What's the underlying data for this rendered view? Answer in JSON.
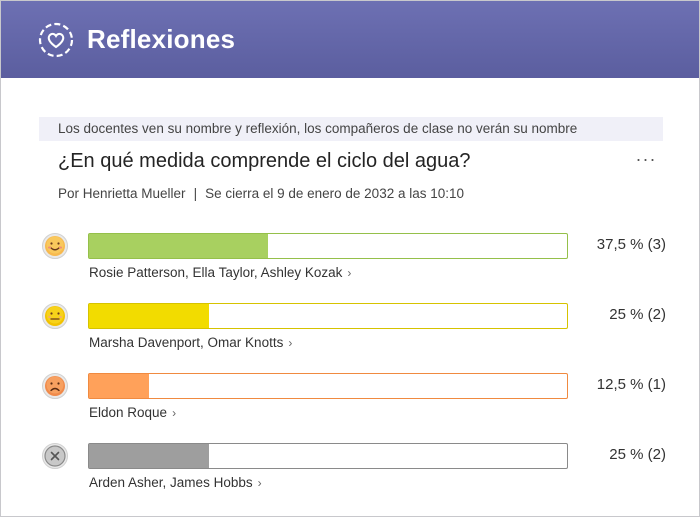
{
  "header": {
    "title": "Reflexiones",
    "logo_icon": "heart-in-circle-icon"
  },
  "notice": "Los docentes ven su nombre y reflexión, los compañeros de clase no verán su nombre",
  "question": "¿En qué medida comprende el ciclo del agua?",
  "more_label": "···",
  "meta": {
    "author": "Por Henrietta Mueller",
    "separator": "|",
    "closes": "Se cierra el 9 de enero de 2032 a las 10:10"
  },
  "responses": [
    {
      "icon": "happy-face-icon",
      "percent_label": "37,5 % (3)",
      "fraction": 0.375,
      "fill_color": "#a8d060",
      "border_color": "#95c04a",
      "names": "Rosie Patterson, Ella Taylor, Ashley Kozak"
    },
    {
      "icon": "neutral-face-icon",
      "percent_label": "25 % (2)",
      "fraction": 0.25,
      "fill_color": "#f2dc00",
      "border_color": "#d6c300",
      "names": "Marsha Davenport, Omar Knotts"
    },
    {
      "icon": "sad-face-icon",
      "percent_label": "12,5 % (1)",
      "fraction": 0.125,
      "fill_color": "#ffa15a",
      "border_color": "#f08a40",
      "names": "Eldon Roque"
    },
    {
      "icon": "no-response-icon",
      "percent_label": "25 % (2)",
      "fraction": 0.25,
      "fill_color": "#9e9e9e",
      "border_color": "#8a8a8a",
      "names": "Arden Asher, James Hobbs"
    }
  ],
  "chevron": "›"
}
